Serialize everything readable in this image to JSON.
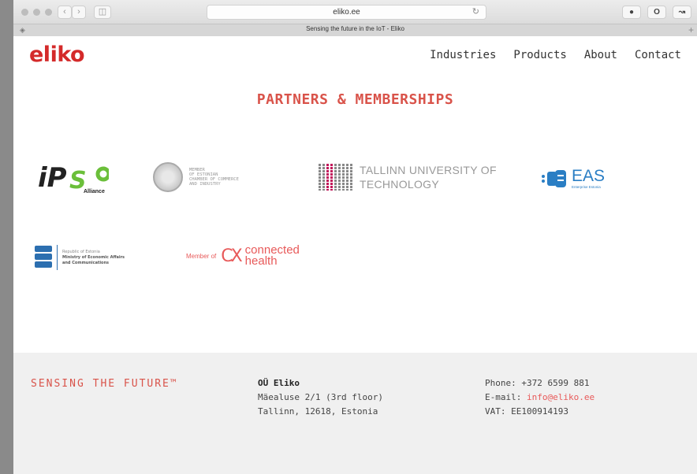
{
  "browser": {
    "url": "eliko.ee",
    "tab_title": "Sensing the future in the IoT - Eliko",
    "back_icon": "chevron-left-icon",
    "forward_icon": "chevron-right-icon"
  },
  "header": {
    "logo": "eliko",
    "nav": [
      "Industries",
      "Products",
      "About",
      "Contact"
    ]
  },
  "main": {
    "heading": "PARTNERS & MEMBERSHIPS",
    "partners": {
      "ipso": {
        "name": "iPSO",
        "sub": "Alliance"
      },
      "chamber": {
        "text": "MEMBER\nOF ESTONIAN\nCHAMBER OF COMMERCE\nAND INDUSTRY"
      },
      "ttu": {
        "line1": "TALLINN UNIVERSITY OF",
        "line2": "TECHNOLOGY"
      },
      "eas": {
        "name": "EAS",
        "sub": "Enterprise Estonia"
      },
      "mineco": {
        "line1": "Republic of Estonia",
        "line2": "Ministry of Economic Affairs",
        "line3": "and Communications"
      },
      "connected": {
        "prefix": "Member of",
        "mark": "CX",
        "line1": "connected",
        "line2": "health"
      }
    }
  },
  "footer": {
    "tagline": "SENSING THE FUTURE™",
    "company": "OÜ Eliko",
    "address1": "Mäealuse 2/1 (3rd floor)",
    "address2": "Tallinn, 12618, Estonia",
    "phone": "Phone: +372 6599 881",
    "email_label": "E-mail: ",
    "email": "info@eliko.ee",
    "vat": "VAT: EE100914193"
  },
  "colors": {
    "brand_red": "#d42a2a",
    "accent_red": "#d9534a",
    "eas_blue": "#2a7ec4"
  }
}
